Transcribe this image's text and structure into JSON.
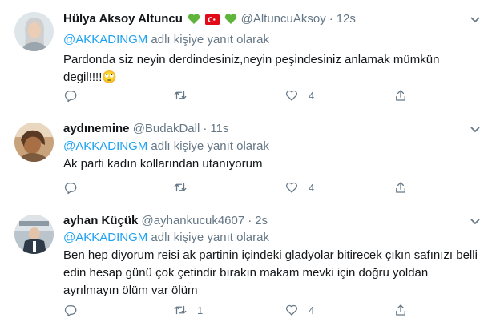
{
  "tweets": [
    {
      "name": "Hülya Aksoy Altuncu",
      "handle": "@AltuncuAksoy",
      "time": "12s",
      "reply_prefix": "@AKKADINGM",
      "reply_suffix": " adlı kişiye yanıt olarak",
      "text": "Pardonda siz neyin derdindesiniz,neyin peşindesiniz anlamak mümkün degil!!!!🙄",
      "reply_count": "",
      "retweet_count": "",
      "like_count": "4"
    },
    {
      "name": "aydınemine",
      "handle": "@BudakDall",
      "time": "11s",
      "reply_prefix": "@AKKADINGM",
      "reply_suffix": " adlı kişiye yanıt olarak",
      "text": "Ak parti kadın kollarından utanıyorum",
      "reply_count": "",
      "retweet_count": "",
      "like_count": "4"
    },
    {
      "name": "ayhan Küçük",
      "handle": "@ayhankucuk4607",
      "time": "2s",
      "reply_prefix": "@AKKADINGM",
      "reply_suffix": " adlı kişiye yanıt olarak",
      "text": "Ben hep diyorum reisi ak partinin içindeki gladyolar bitirecek çıkın safınızı belli edin hesap günü çok çetindir bırakın makam mevki için doğru yoldan ayrılmayın ölüm  var ölüm",
      "reply_count": "",
      "retweet_count": "1",
      "like_count": "4"
    }
  ],
  "icons": {
    "reply": "reply-icon",
    "retweet": "retweet-icon",
    "like": "heart-icon",
    "share": "share-icon",
    "more": "chevron-down-icon"
  },
  "colors": {
    "accent": "#1da1f2",
    "muted": "#657786",
    "text": "#14171a",
    "border": "#e6ecf0"
  }
}
